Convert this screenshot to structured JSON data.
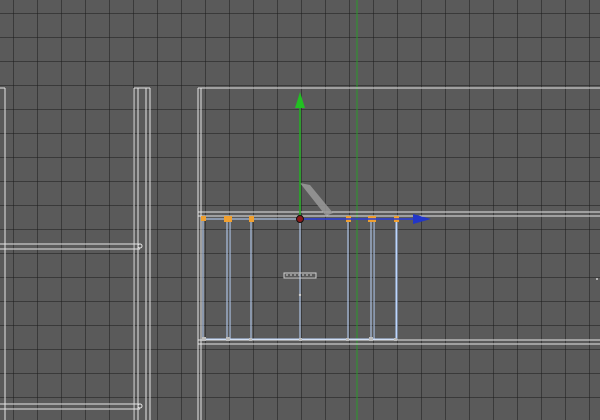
{
  "viewport": {
    "type": "3d-viewport-top",
    "background_color": "#5a5a5a",
    "grid_color": "#2f2f2f",
    "wire_color": "#e6e6e6",
    "selected_wire_color": "#bcd6ff",
    "vertex_color": "#f0a030",
    "axis_y_color": "#22b022",
    "axis_x_color": "#2236c8"
  },
  "gizmo": {
    "type": "move-gizmo",
    "axes": [
      "x-axis-handle",
      "y-axis-handle"
    ]
  }
}
